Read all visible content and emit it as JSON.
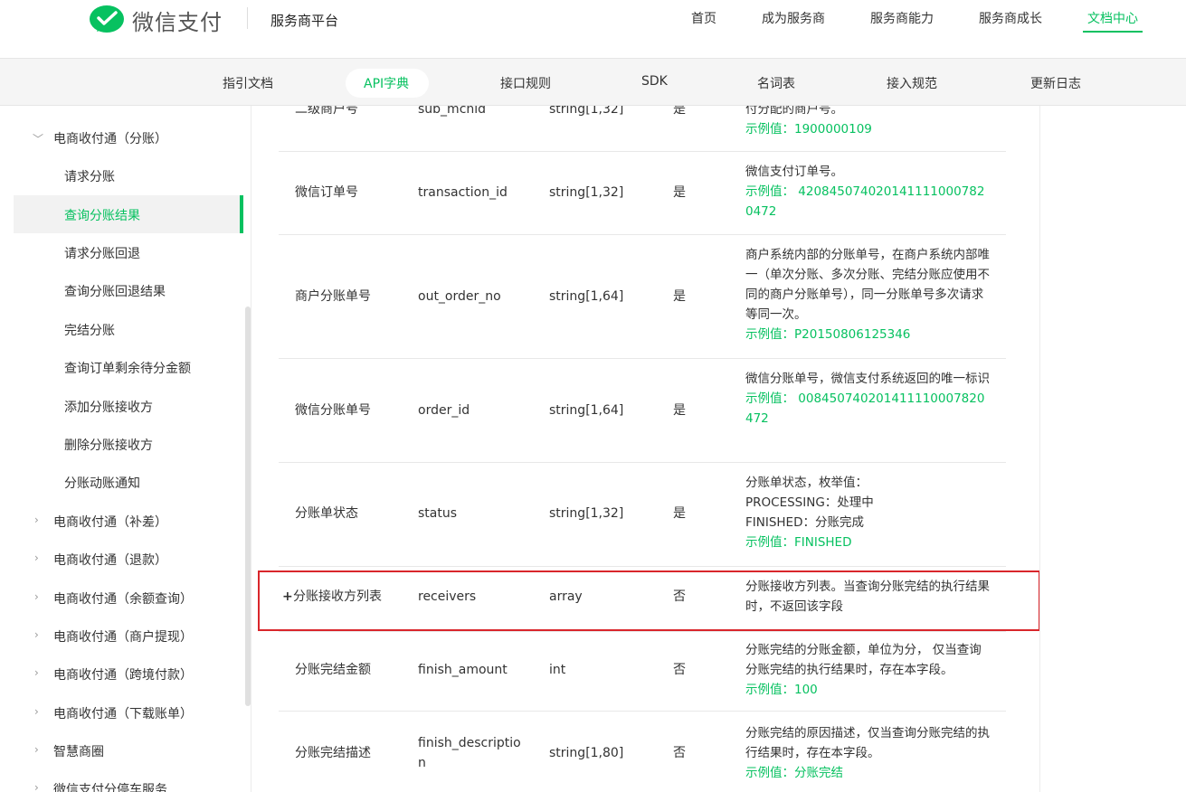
{
  "header": {
    "brand": "微信支付",
    "platform": "服务商平台",
    "nav": [
      "首页",
      "成为服务商",
      "服务商能力",
      "服务商成长",
      "文档中心"
    ],
    "nav_active": "文档中心",
    "brand_color": "#07c160"
  },
  "subnav": [
    "指引文档",
    "API字典",
    "接口规则",
    "SDK",
    "名词表",
    "接入规范",
    "更新日志"
  ],
  "sidebar": {
    "group": "电商收付通（分账）",
    "children": [
      "请求分账",
      "查询分账结果",
      "请求分账回退",
      "查询分账回退结果",
      "完结分账",
      "查询订单剩余待分金额",
      "添加分账接收方",
      "删除分账接收方",
      "分账动账通知"
    ],
    "active": "查询分账结果",
    "collapsed": [
      "电商收付通（补差）",
      "电商收付通（退款）",
      "电商收付通（余额查询）",
      "电商收付通（商户提现）",
      "电商收付通（跨境付款）",
      "电商收付通（下载账单）",
      "智慧商圈",
      "微信支付分停车服务"
    ]
  },
  "table": {
    "rows": [
      {
        "name": "二级商户号",
        "field": "sub_mchid",
        "type": "string[1,32]",
        "required": "是",
        "desc": [
          "付分配的商户号。"
        ],
        "example": "示例值：1900000109"
      },
      {
        "name": "微信订单号",
        "field": "transaction_id",
        "type": "string[1,32]",
        "required": "是",
        "desc": [
          "微信支付订单号。"
        ],
        "example": "示例值： 4208450740201411110007820472"
      },
      {
        "name": "商户分账单号",
        "field": "out_order_no",
        "type": "string[1,64]",
        "required": "是",
        "desc": [
          "商户系统内部的分账单号，在商户系统内部唯一（单次分账、多次分账、完结分账应使用不同的商户分账单号），同一分账单号多次请求等同一次。"
        ],
        "example": "示例值：P20150806125346"
      },
      {
        "name": "微信分账单号",
        "field": "order_id",
        "type": "string[1,64]",
        "required": "是",
        "desc": [
          "微信分账单号，微信支付系统返回的唯一标识"
        ],
        "example": "示例值： 008450740201411110007820472"
      },
      {
        "name": "分账单状态",
        "field": "status",
        "type": "string[1,32]",
        "required": "是",
        "desc": [
          "分账单状态，枚举值：",
          "PROCESSING：处理中",
          "FINISHED：分账完成"
        ],
        "example": "示例值：FINISHED"
      },
      {
        "name": "分账接收方列表",
        "field": "receivers",
        "type": "array",
        "required": "否",
        "desc": [
          "分账接收方列表。当查询分账完结的执行结果时，不返回该字段"
        ],
        "example": "",
        "expandable": true
      },
      {
        "name": "分账完结金额",
        "field": "finish_amount",
        "type": "int",
        "required": "否",
        "desc": [
          "分账完结的分账金额，单位为分， 仅当查询分账完结的执行结果时，存在本字段。"
        ],
        "example": "示例值：100"
      },
      {
        "name": "分账完结描述",
        "field": "finish_description",
        "type": "string[1,80]",
        "required": "否",
        "desc": [
          "分账完结的原因描述，仅当查询分账完结的执行结果时，存在本字段。"
        ],
        "example": "示例值：分账完结"
      }
    ]
  }
}
